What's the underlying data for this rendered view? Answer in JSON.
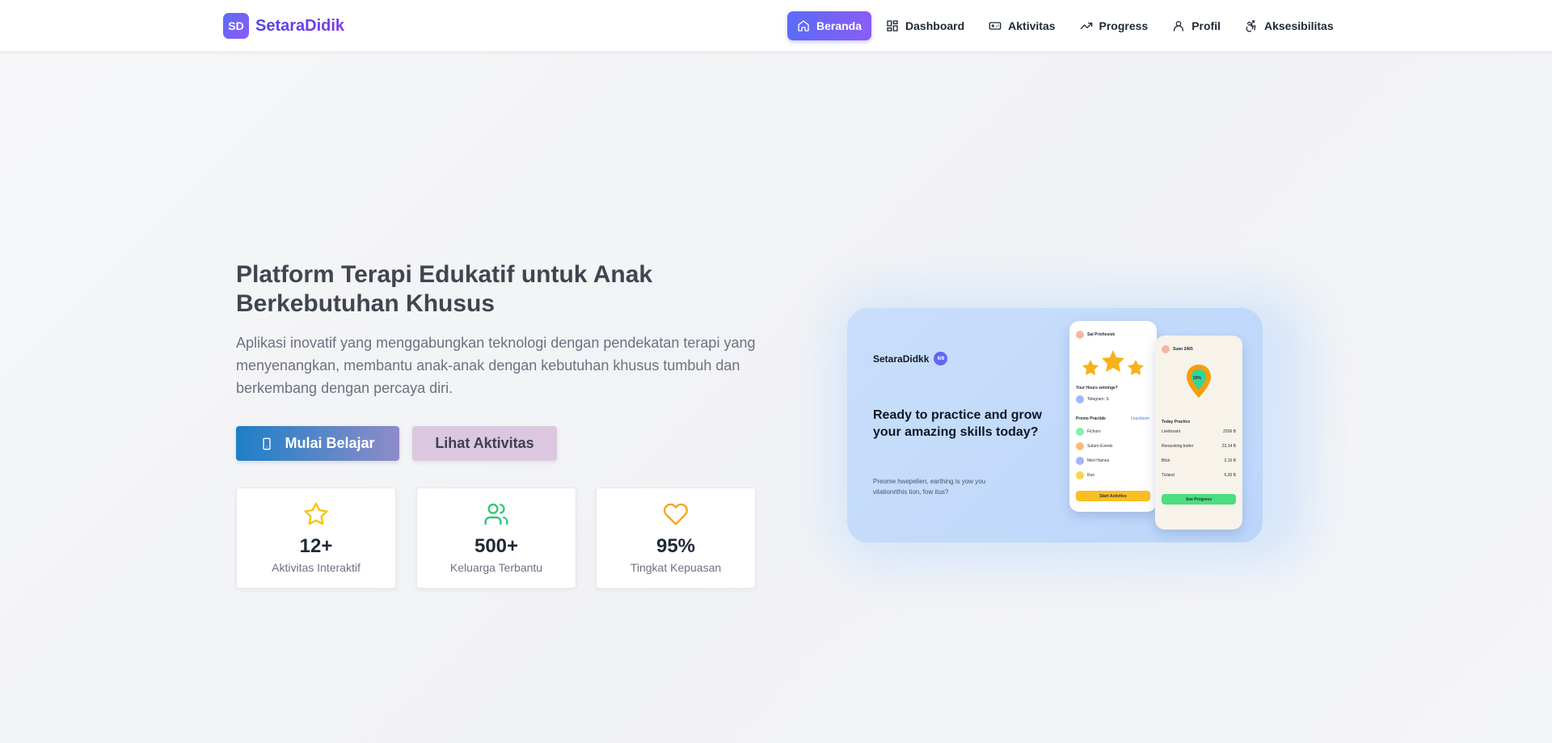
{
  "nav": {
    "brand_logo": "SD",
    "brand_name": "SetaraDidik",
    "items": [
      {
        "label": "Beranda",
        "icon": "home-icon"
      },
      {
        "label": "Dashboard",
        "icon": "grid-icon"
      },
      {
        "label": "Aktivitas",
        "icon": "gamepad-icon"
      },
      {
        "label": "Progress",
        "icon": "trending-up-icon"
      },
      {
        "label": "Profil",
        "icon": "user-icon"
      },
      {
        "label": "Aksesibilitas",
        "icon": "accessibility-icon"
      }
    ]
  },
  "hero": {
    "title": "Platform Terapi Edukatif untuk Anak Berkebutuhan Khusus",
    "description": "Aplikasi inovatif yang menggabungkan teknologi dengan pendekatan terapi yang menyenangkan, membantu anak-anak dengan kebutuhan khusus tumbuh dan berkembang dengan percaya diri.",
    "primary_button": "Mulai Belajar",
    "secondary_button": "Lihat Aktivitas"
  },
  "stats": [
    {
      "value": "12+",
      "label": "Aktivitas Interaktif",
      "icon": "star-icon",
      "color": "#f5c518"
    },
    {
      "value": "500+",
      "label": "Keluarga Terbantu",
      "icon": "users-icon",
      "color": "#34c77b"
    },
    {
      "value": "95%",
      "label": "Tingkat Kepuasan",
      "icon": "heart-icon",
      "color": "#f5a623"
    }
  ],
  "promo": {
    "brand": "SetaraDidkk",
    "badge": "6/8",
    "headline": "Ready to practice and grow your amazing skills today?",
    "subtext": "Preome hwepelien, earthing is yow you vitationrithis tion, fow itus?",
    "phone1": {
      "user": "Sat Prishesisk",
      "section": "Your Hours vetninge?",
      "item_top": "Telegram: S",
      "list_header": "Promo Practide",
      "list_link": "Leackbom",
      "items": [
        "Fichurn",
        "Suture Events",
        "Mert Hames",
        "Run"
      ],
      "button": "Start Activitvs"
    },
    "phone2": {
      "user": "Suan 2465",
      "progress": "50%",
      "list_header": "Today Practice",
      "items": [
        {
          "name": "Livefunant",
          "value": "2506 B"
        },
        {
          "name": "Renaosting butter",
          "value": "23,14 B"
        },
        {
          "name": "Blick",
          "value": "2,15 B"
        },
        {
          "name": "Tizland",
          "value": "6,30 B"
        }
      ],
      "button": "See Progress"
    }
  }
}
